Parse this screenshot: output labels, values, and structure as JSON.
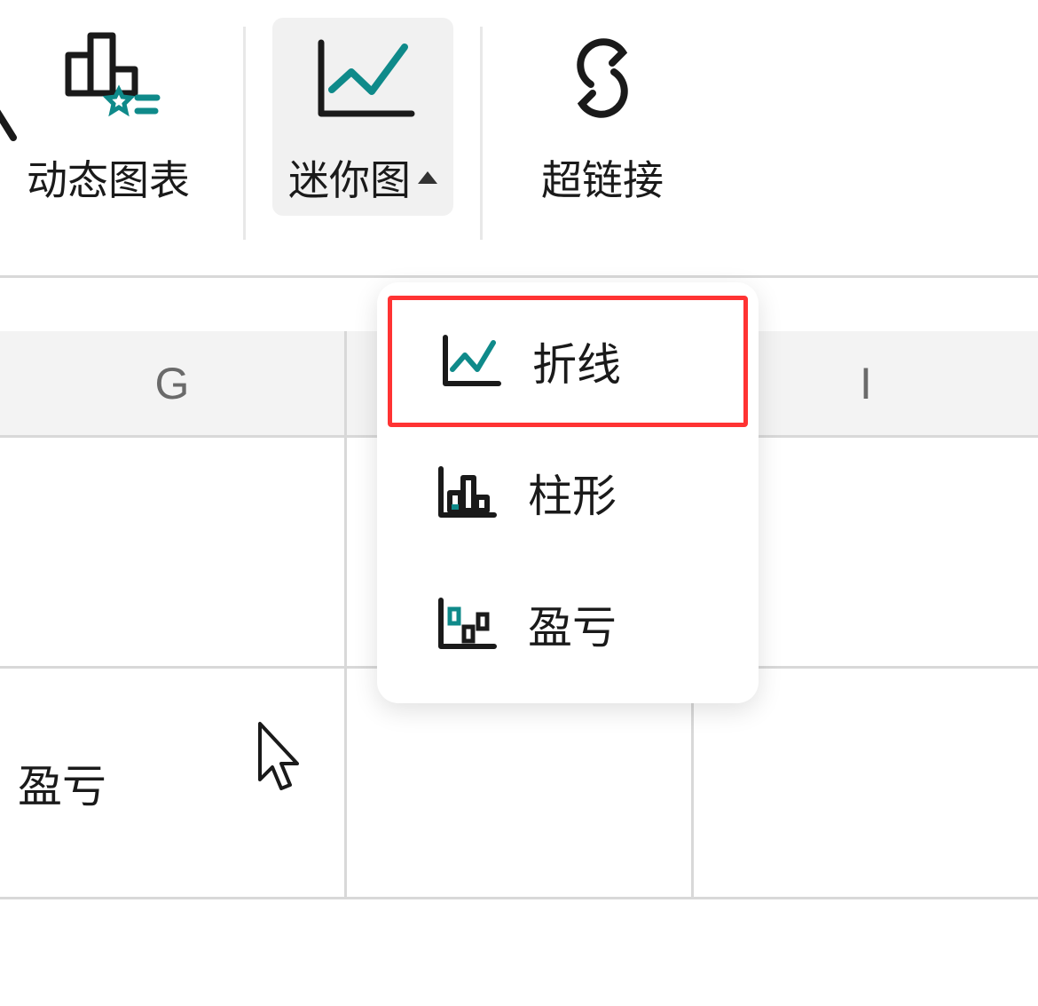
{
  "toolbar": {
    "dynamic_chart": {
      "label": "动态图表"
    },
    "sparkline": {
      "label": "迷你图"
    },
    "hyperlink": {
      "label": "超链接"
    }
  },
  "dropdown": {
    "items": [
      {
        "label": "折线",
        "icon": "sparkline-line-icon"
      },
      {
        "label": "柱形",
        "icon": "sparkline-column-icon"
      },
      {
        "label": "盈亏",
        "icon": "sparkline-winloss-icon"
      }
    ]
  },
  "columns": {
    "g": "G",
    "i": "I"
  },
  "cells": {
    "row0_col0": "盈亏"
  }
}
